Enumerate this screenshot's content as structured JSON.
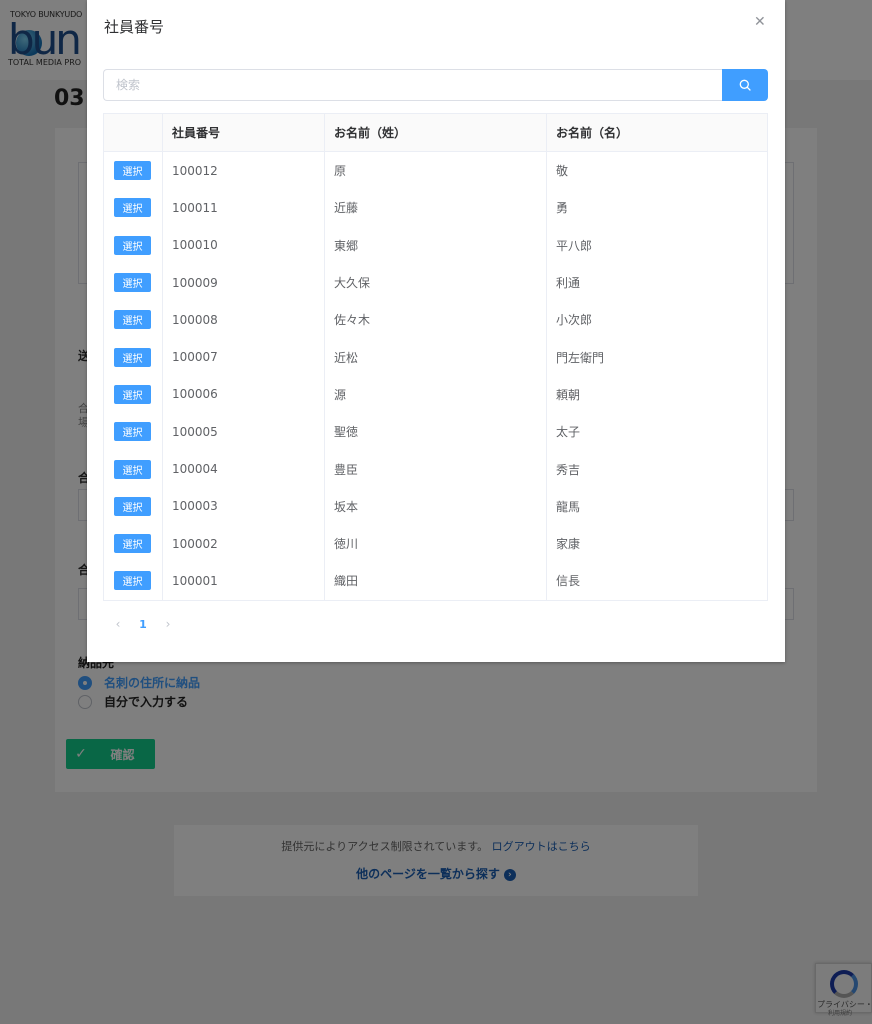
{
  "background": {
    "logo": {
      "top_text": "TOKYO BUNKYUDO",
      "mark": "bun",
      "bottom_text": "TOTAL MEDIA PRO"
    },
    "page_title": "03",
    "fragments": [
      "送",
      "合",
      "場",
      "合",
      "合"
    ],
    "delivery": {
      "title": "納品先",
      "options": [
        {
          "label": "名刺の住所に納品",
          "checked": true
        },
        {
          "label": "自分で入力する",
          "checked": false
        }
      ]
    },
    "confirm_label": "確認",
    "access": {
      "text": "提供元によりアクセス制限されています。",
      "logout_link": "ログアウトはこちら",
      "other_pages": "他のページを一覧から探す"
    },
    "recaptcha": {
      "text": "プライバシー・",
      "terms": "利用規約"
    }
  },
  "dialog": {
    "title": "社員番号",
    "search_placeholder": "検索",
    "columns": [
      "",
      "社員番号",
      "お名前（姓）",
      "お名前（名）"
    ],
    "select_label": "選択",
    "rows": [
      {
        "id": "100012",
        "last": "原",
        "first": "敬"
      },
      {
        "id": "100011",
        "last": "近藤",
        "first": "勇"
      },
      {
        "id": "100010",
        "last": "東郷",
        "first": "平八郎"
      },
      {
        "id": "100009",
        "last": "大久保",
        "first": "利通"
      },
      {
        "id": "100008",
        "last": "佐々木",
        "first": "小次郎"
      },
      {
        "id": "100007",
        "last": "近松",
        "first": "門左衛門"
      },
      {
        "id": "100006",
        "last": "源",
        "first": "頼朝"
      },
      {
        "id": "100005",
        "last": "聖徳",
        "first": "太子"
      },
      {
        "id": "100004",
        "last": "豊臣",
        "first": "秀吉"
      },
      {
        "id": "100003",
        "last": "坂本",
        "first": "龍馬"
      },
      {
        "id": "100002",
        "last": "徳川",
        "first": "家康"
      },
      {
        "id": "100001",
        "last": "織田",
        "first": "信長"
      }
    ],
    "pagination": {
      "current_page": "1"
    }
  },
  "colors": {
    "primary": "#409eff",
    "confirm": "#13ce8c",
    "link": "#1a5fb4"
  }
}
